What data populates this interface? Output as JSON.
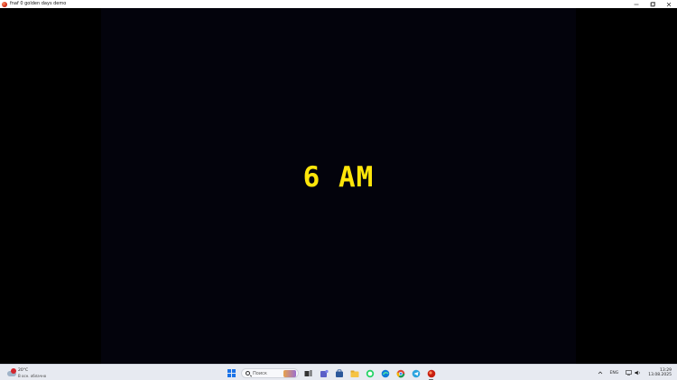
{
  "window": {
    "title": "fnaf 0 golden days demo",
    "controls": {
      "minimize_icon": "minimize-icon",
      "maximize_icon": "maximize-icon",
      "close_icon": "close-icon"
    }
  },
  "game": {
    "time_text": "6 AM",
    "text_color": "#ffe60a",
    "background": "#03030c"
  },
  "taskbar": {
    "weather": {
      "temperature": "20°C",
      "description": "В осн. облачно"
    },
    "search": {
      "placeholder": "Поиск"
    },
    "tray": {
      "language": "ENG",
      "time": "13:29",
      "date": "13.08.2025"
    },
    "pinned_apps": [
      "file-explorer-icon",
      "teams-icon",
      "store-icon",
      "whatsapp-icon",
      "edge-icon",
      "chrome-icon",
      "telegram-icon",
      "game-app-icon"
    ]
  }
}
